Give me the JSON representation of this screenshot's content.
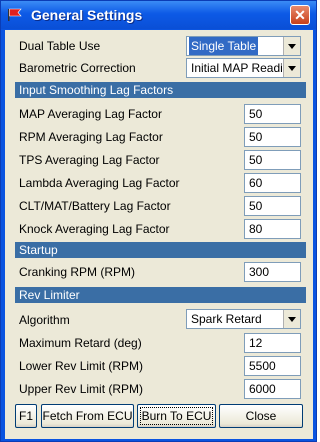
{
  "window": {
    "title": "General Settings",
    "close_glyph": "✕"
  },
  "fields": {
    "dual_table": {
      "label": "Dual Table Use",
      "value": "Single Table"
    },
    "barometric": {
      "label": "Barometric Correction",
      "value": "Initial MAP Reading"
    }
  },
  "sections": {
    "lag": "Input Smoothing Lag Factors",
    "startup": "Startup",
    "rev": "Rev Limiter"
  },
  "lag_factors": [
    {
      "label": "MAP Averaging Lag Factor",
      "value": "50"
    },
    {
      "label": "RPM Averaging Lag Factor",
      "value": "50"
    },
    {
      "label": "TPS Averaging Lag Factor",
      "value": "50"
    },
    {
      "label": "Lambda Averaging Lag Factor",
      "value": "60"
    },
    {
      "label": "CLT/MAT/Battery Lag Factor",
      "value": "50"
    },
    {
      "label": "Knock Averaging Lag Factor",
      "value": "80"
    }
  ],
  "startup": {
    "cranking": {
      "label": "Cranking RPM (RPM)",
      "value": "300"
    }
  },
  "rev": {
    "algorithm": {
      "label": "Algorithm",
      "value": "Spark Retard"
    },
    "max_retard": {
      "label": "Maximum Retard (deg)",
      "value": "12"
    },
    "lower": {
      "label": "Lower Rev Limit (RPM)",
      "value": "5500"
    },
    "upper": {
      "label": "Upper Rev Limit (RPM)",
      "value": "6000"
    }
  },
  "buttons": {
    "f1": "F1",
    "fetch": "Fetch From ECU",
    "burn": "Burn To ECU",
    "close": "Close"
  }
}
